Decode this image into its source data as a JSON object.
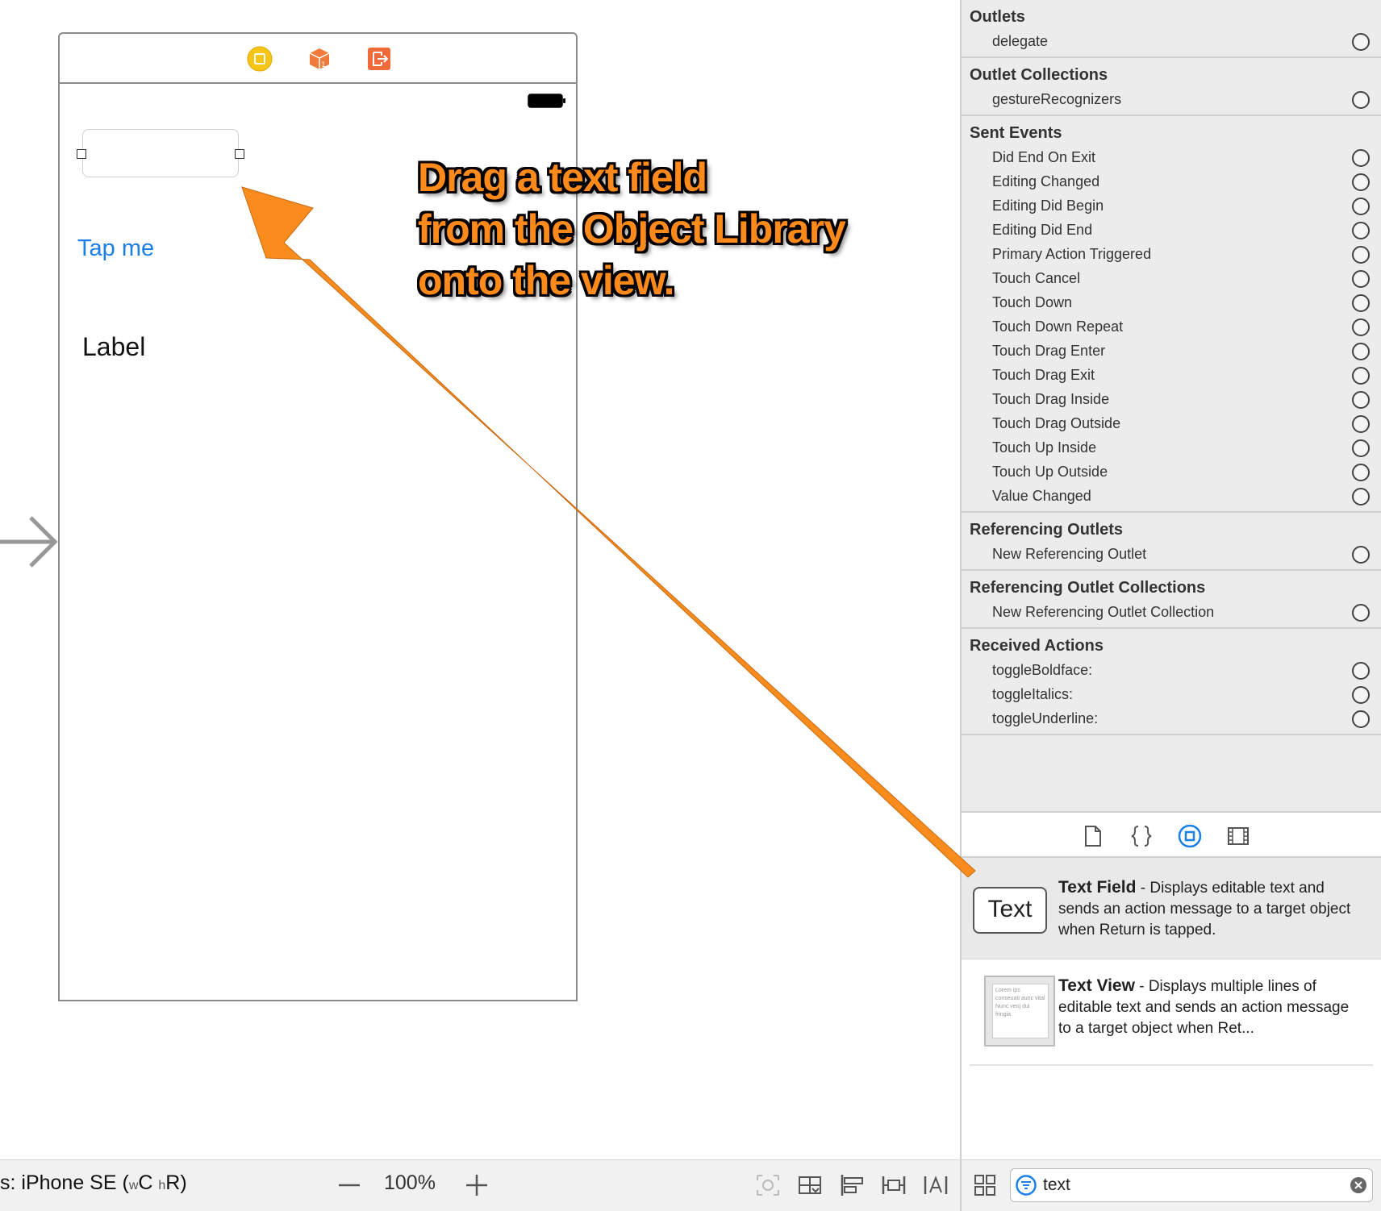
{
  "canvas": {
    "button_title": "Tap me",
    "label_text": "Label",
    "annotation_lines": [
      "Drag a text field",
      "from the Object Library",
      "onto the view."
    ]
  },
  "bottom_bar": {
    "device_prefix": "s: iPhone SE (",
    "width_class_small": "w",
    "width_class": "C",
    "height_class_small": "h",
    "height_class": "R)",
    "zoom": "100%"
  },
  "connections": {
    "outlets": {
      "title": "Outlets",
      "items": [
        "delegate"
      ]
    },
    "outlet_collections": {
      "title": "Outlet Collections",
      "items": [
        "gestureRecognizers"
      ]
    },
    "sent_events": {
      "title": "Sent Events",
      "items": [
        "Did End On Exit",
        "Editing Changed",
        "Editing Did Begin",
        "Editing Did End",
        "Primary Action Triggered",
        "Touch Cancel",
        "Touch Down",
        "Touch Down Repeat",
        "Touch Drag Enter",
        "Touch Drag Exit",
        "Touch Drag Inside",
        "Touch Drag Outside",
        "Touch Up Inside",
        "Touch Up Outside",
        "Value Changed"
      ]
    },
    "referencing_outlets": {
      "title": "Referencing Outlets",
      "items": [
        "New Referencing Outlet"
      ]
    },
    "referencing_outlet_collections": {
      "title": "Referencing Outlet Collections",
      "items": [
        "New Referencing Outlet Collection"
      ]
    },
    "received_actions": {
      "title": "Received Actions",
      "items": [
        "toggleBoldface:",
        "toggleItalics:",
        "toggleUnderline:"
      ]
    }
  },
  "library": {
    "items": [
      {
        "thumb_text": "Text",
        "name": "Text Field",
        "description": " - Displays editable text and sends an action message to a target object when Return is tapped."
      },
      {
        "thumb_text": "Lorem ips conseuati aunc vital Nunc venj dui fringia",
        "name": "Text View",
        "description": " - Displays multiple lines of editable text and sends an action message to a target object when Ret..."
      }
    ],
    "search_value": "text"
  },
  "colors": {
    "accent": "#1a7fe6",
    "annotation": "#ff8a1c",
    "arrow": "#fa8c1e"
  }
}
